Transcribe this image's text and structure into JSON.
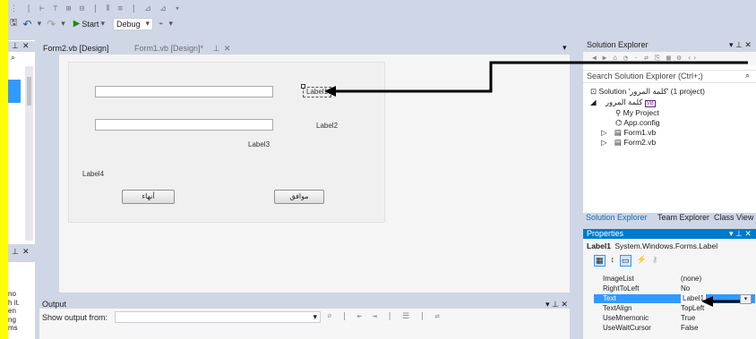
{
  "toolbar": {
    "row1_glyphs": "⋮ | ⊢ ⊤ ⊞ ⊟ | ⫴ ≡ | ⊿ ⊿ ▾",
    "undo_glyph": "↶",
    "redo_glyph": "↷",
    "start_label": "Start",
    "config_value": "Debug",
    "tool_glyph": "⌁"
  },
  "left_dock": {
    "pin_glyph": "⊥",
    "close_glyph": "✕",
    "search_glyph": "⌕",
    "pin2_glyph": "⊥",
    "close2_glyph": "✕",
    "lines": [
      "no",
      "h it.",
      "en",
      "ng",
      "ms"
    ]
  },
  "tabs": [
    {
      "label": "Form2.vb [Design]"
    },
    {
      "label": "Form1.vb [Design]*"
    }
  ],
  "tab_pin_glyph": "⊥",
  "tab_close_glyph": "✕",
  "tab_overflow_glyph": "▾",
  "form": {
    "label1": "Label1",
    "label2": "Label2",
    "label3": "Label3",
    "label4": "Label4",
    "button_left": "أنهاء",
    "button_right": "موافق"
  },
  "solution_explorer": {
    "title": "Solution Explorer",
    "title_glyphs": "▾ ⊥ ✕",
    "search_placeholder": "Search Solution Explorer (Ctrl+;)",
    "search_glyph": "⌕",
    "toolbar_glyphs": "◀ ▶ ⌂ ◔ · ⇄ ⎘ ▦ ⚙ ‹›",
    "solution_line": "Solution 'كلمة المرور' (1 project)",
    "project_name": "كلمة المرور",
    "items": [
      "My Project",
      "App.config",
      "Form1.vb",
      "Form2.vb"
    ],
    "bottom_tabs": [
      "Solution Explorer",
      "Team Explorer",
      "Class View"
    ]
  },
  "properties": {
    "title": "Properties",
    "title_glyphs": "▾ ⊥ ✕",
    "object_name": "Label1",
    "object_type": "System.Windows.Forms.Label",
    "toolbar_glyphs": [
      "▦",
      "↕",
      "▭",
      "⚡",
      "⚷"
    ],
    "rows": [
      {
        "name": "ImageList",
        "value": "(none)"
      },
      {
        "name": "RightToLeft",
        "value": "No"
      },
      {
        "name": "Text",
        "value": "Label1"
      },
      {
        "name": "TextAlign",
        "value": "TopLeft"
      },
      {
        "name": "UseMnemonic",
        "value": "True"
      },
      {
        "name": "UseWaitCursor",
        "value": "False"
      }
    ]
  },
  "output": {
    "title": "Output",
    "title_glyphs": "▾ ⊥ ✕",
    "show_from_label": "Show output from:",
    "toolbar_glyphs": "⌕ | ⇤ ⇥ | ☰ | ⇌"
  },
  "colors": {
    "selection": "#3399ff",
    "ide_background": "#cfd6e5",
    "highlight": "#ffff00"
  }
}
